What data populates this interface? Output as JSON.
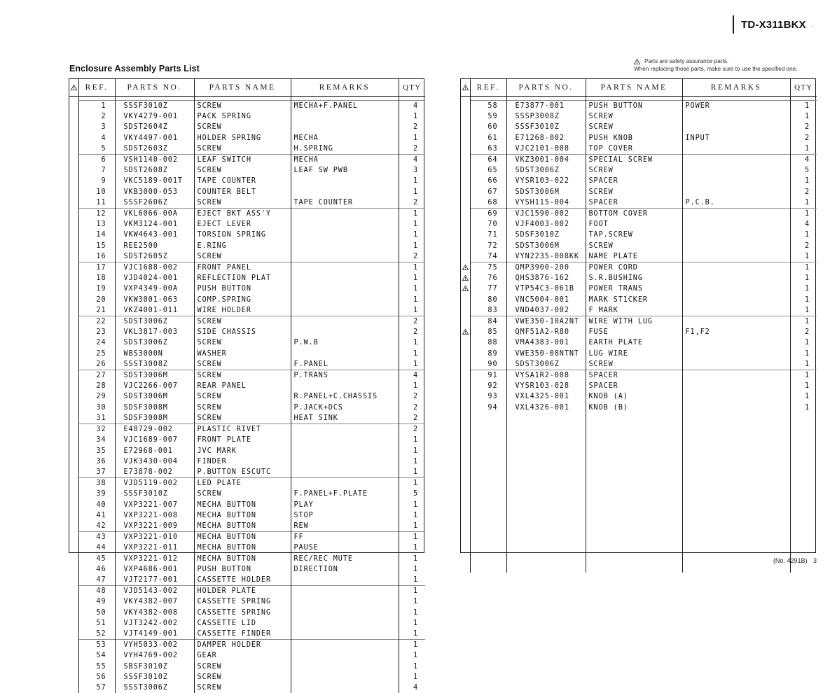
{
  "header": {
    "model": "TD-X311BKX",
    "model_trailing_mark": "."
  },
  "section": {
    "title": "Enclosure Assembly Parts List"
  },
  "safety_note": {
    "icon": "warning-triangle-icon",
    "line1": "Parts are safety assurance parts.",
    "line2": "When replacing those parts, make sure to use the specified one."
  },
  "table_columns": {
    "warn": "",
    "ref": "REF.",
    "parts_no": "PARTS NO.",
    "parts_name": "PARTS NAME",
    "remarks": "REMARKS",
    "qty": "QTY"
  },
  "left_table": {
    "rows": [
      {
        "warn": "",
        "ref": "1",
        "no": "SSSF3010Z",
        "name": "SCREW",
        "remarks": "MECHA+F.PANEL",
        "qty": "4",
        "group": true
      },
      {
        "warn": "",
        "ref": "2",
        "no": "VKY4279-001",
        "name": "PACK SPRING",
        "remarks": "",
        "qty": "1"
      },
      {
        "warn": "",
        "ref": "3",
        "no": "SDST2604Z",
        "name": "SCREW",
        "remarks": "",
        "qty": "2"
      },
      {
        "warn": "",
        "ref": "4",
        "no": "VKY4497-001",
        "name": "HOLDER SPRING",
        "remarks": "MECHA",
        "qty": "1"
      },
      {
        "warn": "",
        "ref": "5",
        "no": "SDST2603Z",
        "name": "SCREW",
        "remarks": "H.SPRING",
        "qty": "2"
      },
      {
        "warn": "",
        "ref": "6",
        "no": "VSH1140-002",
        "name": "LEAF SWITCH",
        "remarks": "MECHA",
        "qty": "4",
        "group": true
      },
      {
        "warn": "",
        "ref": "7",
        "no": "SDST2608Z",
        "name": "SCREW",
        "remarks": "LEAF SW PWB",
        "qty": "3"
      },
      {
        "warn": "",
        "ref": "9",
        "no": "VKC5189-001T",
        "name": "TAPE COUNTER",
        "remarks": "",
        "qty": "1"
      },
      {
        "warn": "",
        "ref": "10",
        "no": "VKB3000-053",
        "name": "COUNTER BELT",
        "remarks": "",
        "qty": "1"
      },
      {
        "warn": "",
        "ref": "11",
        "no": "SSSF2606Z",
        "name": "SCREW",
        "remarks": "TAPE COUNTER",
        "qty": "2"
      },
      {
        "warn": "",
        "ref": "12",
        "no": "VKL6066-00A",
        "name": "EJECT BKT ASS'Y",
        "remarks": "",
        "qty": "1",
        "group": true
      },
      {
        "warn": "",
        "ref": "13",
        "no": "VKM3124-001",
        "name": "EJECT LEVER",
        "remarks": "",
        "qty": "1"
      },
      {
        "warn": "",
        "ref": "14",
        "no": "VKW4643-001",
        "name": "TORSION SPRING",
        "remarks": "",
        "qty": "1"
      },
      {
        "warn": "",
        "ref": "15",
        "no": "REE2500",
        "name": "E.RING",
        "remarks": "",
        "qty": "1"
      },
      {
        "warn": "",
        "ref": "16",
        "no": "SDST2605Z",
        "name": "SCREW",
        "remarks": "",
        "qty": "2"
      },
      {
        "warn": "",
        "ref": "17",
        "no": "VJC1688-002",
        "name": "FRONT PANEL",
        "remarks": "",
        "qty": "1",
        "group": true
      },
      {
        "warn": "",
        "ref": "18",
        "no": "VJD4024-001",
        "name": "REFLECTION PLAT",
        "remarks": "",
        "qty": "1"
      },
      {
        "warn": "",
        "ref": "19",
        "no": "VXP4349-00A",
        "name": "PUSH BUTTON",
        "remarks": "",
        "qty": "1"
      },
      {
        "warn": "",
        "ref": "20",
        "no": "VKW3001-063",
        "name": "COMP.SPRING",
        "remarks": "",
        "qty": "1"
      },
      {
        "warn": "",
        "ref": "21",
        "no": "VKZ4001-011",
        "name": "WIRE HOLDER",
        "remarks": "",
        "qty": "1"
      },
      {
        "warn": "",
        "ref": "22",
        "no": "SDST3006Z",
        "name": "SCREW",
        "remarks": "",
        "qty": "2",
        "group": true
      },
      {
        "warn": "",
        "ref": "23",
        "no": "VKL3817-003",
        "name": "SIDE CHASSIS",
        "remarks": "",
        "qty": "2"
      },
      {
        "warn": "",
        "ref": "24",
        "no": "SDST3006Z",
        "name": "SCREW",
        "remarks": "P.W.B",
        "qty": "1"
      },
      {
        "warn": "",
        "ref": "25",
        "no": "WBS3000N",
        "name": "WASHER",
        "remarks": "",
        "qty": "1"
      },
      {
        "warn": "",
        "ref": "26",
        "no": "SSST3008Z",
        "name": "SCREW",
        "remarks": "F.PANEL",
        "qty": "1"
      },
      {
        "warn": "",
        "ref": "27",
        "no": "SDST3006M",
        "name": "SCREW",
        "remarks": "P.TRANS",
        "qty": "4",
        "group": true
      },
      {
        "warn": "",
        "ref": "28",
        "no": "VJC2266-007",
        "name": "REAR PANEL",
        "remarks": "",
        "qty": "1"
      },
      {
        "warn": "",
        "ref": "29",
        "no": "SDST3006M",
        "name": "SCREW",
        "remarks": "R.PANEL+C.CHASSIS",
        "qty": "2"
      },
      {
        "warn": "",
        "ref": "30",
        "no": "SDSF3008M",
        "name": "SCREW",
        "remarks": "P.JACK+DCS",
        "qty": "2"
      },
      {
        "warn": "",
        "ref": "31",
        "no": "SDSF3008M",
        "name": "SCREW",
        "remarks": "HEAT SINK",
        "qty": "2"
      },
      {
        "warn": "",
        "ref": "32",
        "no": "E48729-002",
        "name": "PLASTIC RIVET",
        "remarks": "",
        "qty": "2",
        "group": true
      },
      {
        "warn": "",
        "ref": "34",
        "no": "VJC1689-007",
        "name": "FRONT PLATE",
        "remarks": "",
        "qty": "1"
      },
      {
        "warn": "",
        "ref": "35",
        "no": "E72968-001",
        "name": "JVC MARK",
        "remarks": "",
        "qty": "1"
      },
      {
        "warn": "",
        "ref": "36",
        "no": "VJK3430-004",
        "name": "FINDER",
        "remarks": "",
        "qty": "1"
      },
      {
        "warn": "",
        "ref": "37",
        "no": "E73878-002",
        "name": "P.BUTTON ESCUTC",
        "remarks": "",
        "qty": "1"
      },
      {
        "warn": "",
        "ref": "38",
        "no": "VJD5119-002",
        "name": "LED PLATE",
        "remarks": "",
        "qty": "1",
        "group": true
      },
      {
        "warn": "",
        "ref": "39",
        "no": "SSSF3010Z",
        "name": "SCREW",
        "remarks": "F.PANEL+F.PLATE",
        "qty": "5"
      },
      {
        "warn": "",
        "ref": "40",
        "no": "VXP3221-007",
        "name": "MECHA BUTTON",
        "remarks": "PLAY",
        "qty": "1"
      },
      {
        "warn": "",
        "ref": "41",
        "no": "VXP3221-008",
        "name": "MECHA BUTTON",
        "remarks": "STOP",
        "qty": "1"
      },
      {
        "warn": "",
        "ref": "42",
        "no": "VXP3221-009",
        "name": "MECHA BUTTON",
        "remarks": "REW",
        "qty": "1"
      },
      {
        "warn": "",
        "ref": "43",
        "no": "VXP3221-010",
        "name": "MECHA BUTTON",
        "remarks": "FF",
        "qty": "1",
        "group": true
      },
      {
        "warn": "",
        "ref": "44",
        "no": "VXP3221-011",
        "name": "MECHA BUTTON",
        "remarks": "PAUSE",
        "qty": "1"
      },
      {
        "warn": "",
        "ref": "45",
        "no": "VXP3221-012",
        "name": "MECHA BUTTON",
        "remarks": "REC/REC MUTE",
        "qty": "1"
      },
      {
        "warn": "",
        "ref": "46",
        "no": "VXP4686-001",
        "name": "PUSH BUTTON",
        "remarks": "DIRECTION",
        "qty": "1"
      },
      {
        "warn": "",
        "ref": "47",
        "no": "VJT2177-001",
        "name": "CASSETTE HOLDER",
        "remarks": "",
        "qty": "1"
      },
      {
        "warn": "",
        "ref": "48",
        "no": "VJD5143-002",
        "name": "HOLDER PLATE",
        "remarks": "",
        "qty": "1",
        "group": true
      },
      {
        "warn": "",
        "ref": "49",
        "no": "VKY4382-007",
        "name": "CASSETTE SPRING",
        "remarks": "",
        "qty": "1"
      },
      {
        "warn": "",
        "ref": "50",
        "no": "VKY4382-008",
        "name": "CASSETTE SPRING",
        "remarks": "",
        "qty": "1"
      },
      {
        "warn": "",
        "ref": "51",
        "no": "VJT3242-002",
        "name": "CASSETTE LID",
        "remarks": "",
        "qty": "1"
      },
      {
        "warn": "",
        "ref": "52",
        "no": "VJT4149-001",
        "name": "CASSETTE FINDER",
        "remarks": "",
        "qty": "1"
      },
      {
        "warn": "",
        "ref": "53",
        "no": "VYH5033-002",
        "name": "DAMPER HOLDER",
        "remarks": "",
        "qty": "1",
        "group": true
      },
      {
        "warn": "",
        "ref": "54",
        "no": "VYH4769-002",
        "name": "GEAR",
        "remarks": "",
        "qty": "1"
      },
      {
        "warn": "",
        "ref": "55",
        "no": "SBSF3010Z",
        "name": "SCREW",
        "remarks": "",
        "qty": "1"
      },
      {
        "warn": "",
        "ref": "56",
        "no": "SSSF3010Z",
        "name": "SCREW",
        "remarks": "",
        "qty": "1"
      },
      {
        "warn": "",
        "ref": "57",
        "no": "SSST3006Z",
        "name": "SCREW",
        "remarks": "",
        "qty": "4"
      }
    ]
  },
  "right_table": {
    "rows": [
      {
        "warn": "",
        "ref": "58",
        "no": "E73877-001",
        "name": "PUSH BUTTON",
        "remarks": "POWER",
        "qty": "1",
        "group": true
      },
      {
        "warn": "",
        "ref": "59",
        "no": "SSSP3008Z",
        "name": "SCREW",
        "remarks": "",
        "qty": "1"
      },
      {
        "warn": "",
        "ref": "60",
        "no": "SSSF3010Z",
        "name": "SCREW",
        "remarks": "",
        "qty": "2"
      },
      {
        "warn": "",
        "ref": "61",
        "no": "E71268-002",
        "name": "PUSH KNOB",
        "remarks": "INPUT",
        "qty": "2"
      },
      {
        "warn": "",
        "ref": "63",
        "no": "VJC2101-008",
        "name": "TOP COVER",
        "remarks": "",
        "qty": "1"
      },
      {
        "warn": "",
        "ref": "64",
        "no": "VKZ3001-004",
        "name": "SPECIAL SCREW",
        "remarks": "",
        "qty": "4",
        "group": true
      },
      {
        "warn": "",
        "ref": "65",
        "no": "SDST3006Z",
        "name": "SCREW",
        "remarks": "",
        "qty": "5"
      },
      {
        "warn": "",
        "ref": "66",
        "no": "VYSR103-022",
        "name": "SPACER",
        "remarks": "",
        "qty": "1"
      },
      {
        "warn": "",
        "ref": "67",
        "no": "SDST3006M",
        "name": "SCREW",
        "remarks": "",
        "qty": "2"
      },
      {
        "warn": "",
        "ref": "68",
        "no": "VYSH115-004",
        "name": "SPACER",
        "remarks": "P.C.B.",
        "qty": "1"
      },
      {
        "warn": "",
        "ref": "69",
        "no": "VJC1590-002",
        "name": "BOTTOM COVER",
        "remarks": "",
        "qty": "1",
        "group": true
      },
      {
        "warn": "",
        "ref": "70",
        "no": "VJF4003-002",
        "name": "FOOT",
        "remarks": "",
        "qty": "4"
      },
      {
        "warn": "",
        "ref": "71",
        "no": "SDSF3010Z",
        "name": "TAP.SCREW",
        "remarks": "",
        "qty": "1"
      },
      {
        "warn": "",
        "ref": "72",
        "no": "SDST3006M",
        "name": "SCREW",
        "remarks": "",
        "qty": "2"
      },
      {
        "warn": "",
        "ref": "74",
        "no": "VYN2235-008KK",
        "name": "NAME PLATE",
        "remarks": "",
        "qty": "1"
      },
      {
        "warn": "!",
        "ref": "75",
        "no": "QMP3900-200",
        "name": "POWER CORD",
        "remarks": "",
        "qty": "1",
        "group": true
      },
      {
        "warn": "!",
        "ref": "76",
        "no": "QHS3876-162",
        "name": "S.R.BUSHING",
        "remarks": "",
        "qty": "1"
      },
      {
        "warn": "!",
        "ref": "77",
        "no": "VTP54C3-061B",
        "name": "POWER TRANS",
        "remarks": "",
        "qty": "1"
      },
      {
        "warn": "",
        "ref": "80",
        "no": "VNC5004-001",
        "name": "MARK ST1CKER",
        "remarks": "",
        "qty": "1"
      },
      {
        "warn": "",
        "ref": "83",
        "no": "VND4037-002",
        "name": "F MARK",
        "remarks": "",
        "qty": "1"
      },
      {
        "warn": "",
        "ref": "84",
        "no": "VWE350-10A2NT",
        "name": "WIRE WITH LUG",
        "remarks": "",
        "qty": "1",
        "group": true
      },
      {
        "warn": "!",
        "ref": "85",
        "no": "QMF51A2-R80",
        "name": "FUSE",
        "remarks": "F1,F2",
        "qty": "2"
      },
      {
        "warn": "",
        "ref": "88",
        "no": "VMA4383-001",
        "name": "EARTH PLATE",
        "remarks": "",
        "qty": "1"
      },
      {
        "warn": "",
        "ref": "89",
        "no": "VWE350-08NTNT",
        "name": "LUG WIRE",
        "remarks": "",
        "qty": "1"
      },
      {
        "warn": "",
        "ref": "90",
        "no": "SDST3006Z",
        "name": "SCREW",
        "remarks": "",
        "qty": "1"
      },
      {
        "warn": "",
        "ref": "91",
        "no": "VYSA1R2-008",
        "name": "SPACER",
        "remarks": "",
        "qty": "1",
        "group": true
      },
      {
        "warn": "",
        "ref": "92",
        "no": "VYSR103-028",
        "name": "SPACER",
        "remarks": "",
        "qty": "1"
      },
      {
        "warn": "",
        "ref": "93",
        "no": "VXL4325-001",
        "name": "KNOB (A)",
        "remarks": "",
        "qty": "1"
      },
      {
        "warn": "",
        "ref": "94",
        "no": "VXL4326-001",
        "name": "KNOB (B)",
        "remarks": "",
        "qty": "1"
      }
    ]
  },
  "footer": {
    "doc_no": "(No. 4291B)",
    "page": "3"
  }
}
